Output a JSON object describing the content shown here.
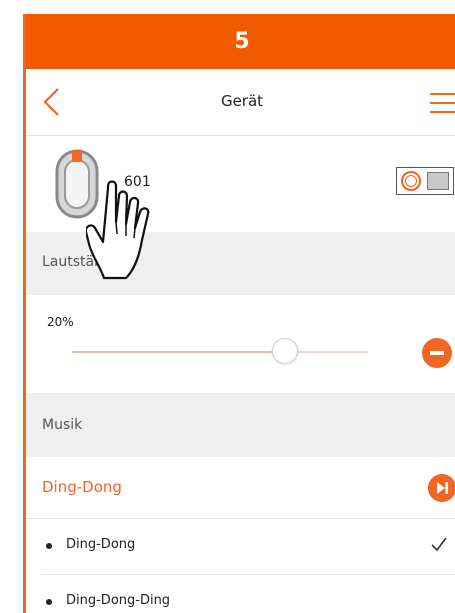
{
  "step": "5",
  "header": {
    "title": "Gerät"
  },
  "device": {
    "label": "601"
  },
  "sections": {
    "volume": "Lautstärke",
    "music": "Musik"
  },
  "volume": {
    "percent_label": "20%",
    "level_fraction": 0.72
  },
  "tone": {
    "selected_title": "Ding-Dong"
  },
  "tone_list": [
    {
      "label": "Ding-Dong",
      "checked": true
    },
    {
      "label": "Ding-Dong-Ding",
      "checked": false
    }
  ],
  "colors": {
    "accent": "#f26522",
    "banner": "#f25a00",
    "section_bg": "#efefef"
  },
  "icons": [
    "back-chevron-icon",
    "menu-icon",
    "doorbell-device-icon",
    "toggle-switch",
    "minus-icon",
    "play-next-icon",
    "checkmark-icon",
    "hand-pointer-icon"
  ]
}
